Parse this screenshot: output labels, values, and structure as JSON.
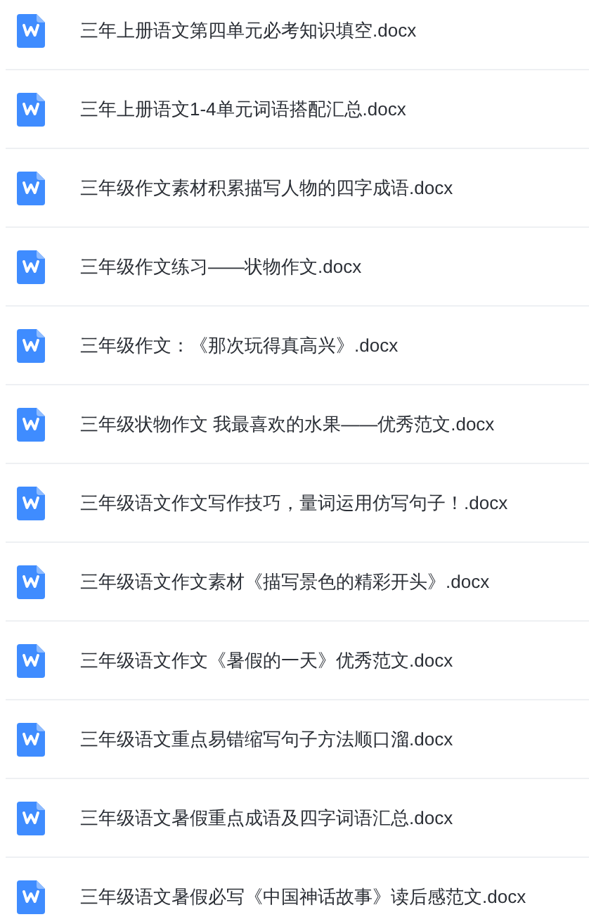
{
  "files": [
    {
      "name": "三年上册语文第四单元必考知识填空.docx"
    },
    {
      "name": "三年上册语文1-4单元词语搭配汇总.docx"
    },
    {
      "name": "三年级作文素材积累描写人物的四字成语.docx"
    },
    {
      "name": "三年级作文练习——状物作文.docx"
    },
    {
      "name": "三年级作文：《那次玩得真高兴》.docx"
    },
    {
      "name": "三年级状物作文 我最喜欢的水果——优秀范文.docx"
    },
    {
      "name": "三年级语文作文写作技巧，量词运用仿写句子！.docx"
    },
    {
      "name": "三年级语文作文素材《描写景色的精彩开头》.docx"
    },
    {
      "name": "三年级语文作文《暑假的一天》优秀范文.docx"
    },
    {
      "name": "三年级语文重点易错缩写句子方法顺口溜.docx"
    },
    {
      "name": "三年级语文暑假重点成语及四字词语汇总.docx"
    },
    {
      "name": "三年级语文暑假必写《中国神话故事》读后感范文.docx"
    }
  ]
}
